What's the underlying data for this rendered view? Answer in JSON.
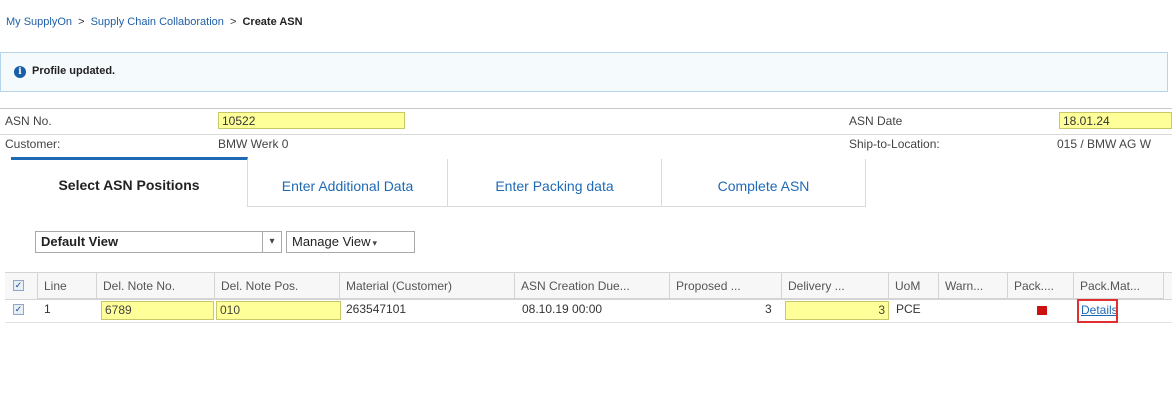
{
  "breadcrumb": {
    "item1": "My SupplyOn",
    "sep1": ">",
    "item2": "Supply Chain Collaboration",
    "sep2": ">",
    "current": "Create ASN"
  },
  "notice": {
    "icon": "info-icon",
    "message": "Profile updated."
  },
  "header": {
    "asn_no_label": "ASN No.",
    "asn_no_value": "10522",
    "asn_date_label": "ASN Date",
    "asn_date_value": "18.01.24",
    "customer_label": "Customer:",
    "customer_value": "BMW Werk 0",
    "ship_to_label": "Ship-to-Location:",
    "ship_to_value": "015 / BMW AG W"
  },
  "tabs": [
    {
      "label": "Select ASN Positions",
      "active": true
    },
    {
      "label": "Enter Additional Data",
      "active": false
    },
    {
      "label": "Enter Packing data",
      "active": false
    },
    {
      "label": "Complete ASN",
      "active": false
    }
  ],
  "toolbar": {
    "view_select": "Default View",
    "view_arrow": "▾",
    "manage_view": "Manage View",
    "manage_caret": "▾"
  },
  "table": {
    "columns": [
      "Line",
      "Del. Note No.",
      "Del. Note Pos.",
      "Material (Customer)",
      "ASN Creation Due...",
      "Proposed ...",
      "Delivery ...",
      "UoM",
      "Warn...",
      "Pack....",
      "Pack.Mat..."
    ],
    "rows": [
      {
        "checked": true,
        "line": "1",
        "del_note_no": "6789",
        "del_note_pos": "010",
        "material": "263547101",
        "asn_creation_due": "08.10.19 00:00",
        "proposed": "3",
        "delivery": "3",
        "uom": "PCE",
        "warn": "",
        "pack_status_color": "#cc1111",
        "pack_mat": "Details"
      }
    ]
  },
  "colors": {
    "accent": "#1f6ab5",
    "field_yellow": "#ffff99",
    "highlight": "#e03030"
  }
}
